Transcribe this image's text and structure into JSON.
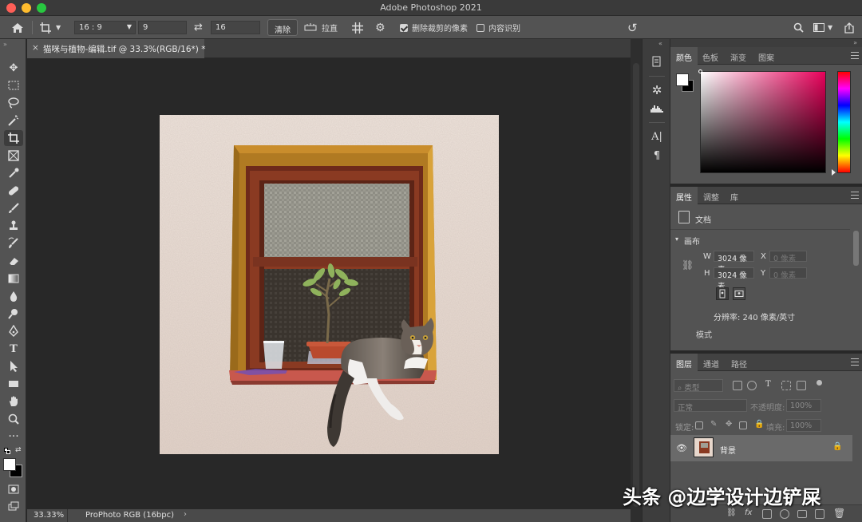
{
  "window": {
    "title": "Adobe Photoshop 2021"
  },
  "options_bar": {
    "ratio": "16 : 9",
    "width": "9",
    "height": "16",
    "clear_label": "清除",
    "straighten_label": "拉直",
    "delete_cropped_label": "删除裁剪的像素",
    "content_aware_label": "内容识别"
  },
  "document": {
    "tab_title": "猫咪与植物-编辑.tif @ 33.3%(RGB/16*) *",
    "close_glyph": "×"
  },
  "status": {
    "zoom": "33.33%",
    "profile": "ProPhoto RGB (16bpc)",
    "arrow": "›"
  },
  "color_panel": {
    "tabs": [
      "颜色",
      "色板",
      "渐变",
      "图案"
    ]
  },
  "properties_panel": {
    "tabs": [
      "属性",
      "调整",
      "库"
    ],
    "doc_label": "文档",
    "section": "画布",
    "w_label": "W",
    "w_value": "3024 像素",
    "h_label": "H",
    "h_value": "3024 像素",
    "x_label": "X",
    "x_value": "0 像素",
    "y_label": "Y",
    "y_value": "0 像素",
    "resolution": "分辨率: 240 像素/英寸",
    "mode_label": "模式"
  },
  "layers_panel": {
    "tabs": [
      "图层",
      "通道",
      "路径"
    ],
    "filter_kind": "类型",
    "blend_mode": "正常",
    "opacity_label": "不透明度:",
    "opacity_value": "100%",
    "lock_label": "锁定:",
    "fill_label": "填充:",
    "fill_value": "100%",
    "layers": [
      {
        "name": "背景",
        "visible": true,
        "locked": true
      }
    ]
  },
  "watermark": "头条 @边学设计边铲屎",
  "colors": {
    "accent": "#e8005a",
    "panel_bg": "#535353",
    "canvas_bg": "#282828"
  }
}
